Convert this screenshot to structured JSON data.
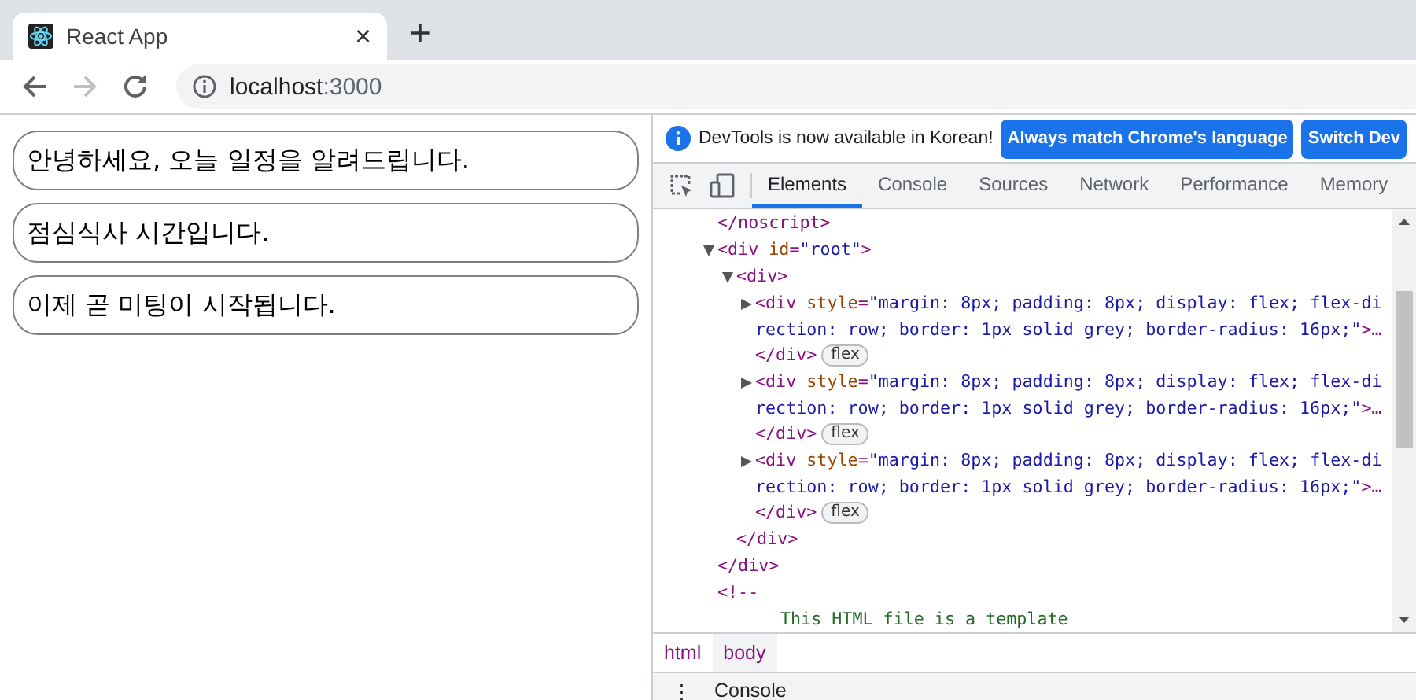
{
  "browser": {
    "tabs": [
      {
        "title": "React App",
        "selected": true,
        "close": "×"
      }
    ],
    "new_tab": "+",
    "nav": {
      "forward_disabled": true
    },
    "address": {
      "host": "localhost",
      "port": ":3000"
    }
  },
  "page": {
    "messages": [
      "안녕하세요, 오늘 일정을 알려드립니다.",
      "점심식사 시간입니다.",
      "이제 곧 미팅이 시작됩니다."
    ]
  },
  "devtools": {
    "infobar": {
      "message": "DevTools is now available in Korean!",
      "buttons": [
        "Always match Chrome's language",
        "Switch Dev"
      ]
    },
    "tabs": [
      {
        "label": "Elements",
        "selected": true
      },
      {
        "label": "Console",
        "selected": false
      },
      {
        "label": "Sources",
        "selected": false
      },
      {
        "label": "Network",
        "selected": false
      },
      {
        "label": "Performance",
        "selected": false
      },
      {
        "label": "Memory",
        "selected": false
      }
    ],
    "dom": [
      {
        "kind": "tag",
        "text": "</noscript>"
      },
      {
        "kind": "tag",
        "text": "<div id=\"root\">",
        "expanded": true,
        "close": "</div>",
        "children": [
          {
            "kind": "tag",
            "text": "<div>",
            "expanded": true,
            "close": "</div>",
            "children": [
              {
                "kind": "tag",
                "text": "<div style=\"margin: 8px; padding: 8px; display: flex; flex-direction: row; border: 1px solid grey; border-radius: 16px;\">…",
                "expanded": false,
                "close": "</div>",
                "badge": "flex"
              },
              {
                "kind": "tag",
                "text": "<div style=\"margin: 8px; padding: 8px; display: flex; flex-direction: row; border: 1px solid grey; border-radius: 16px;\">…",
                "expanded": false,
                "close": "</div>",
                "badge": "flex"
              },
              {
                "kind": "tag",
                "text": "<div style=\"margin: 8px; padding: 8px; display: flex; flex-direction: row; border: 1px solid grey; border-radius: 16px;\">…",
                "expanded": false,
                "close": "</div>",
                "badge": "flex"
              }
            ]
          }
        ]
      },
      {
        "kind": "comment",
        "text": "<!--",
        "children": [
          {
            "kind": "comment-text",
            "text": "This HTML file is a template"
          }
        ]
      }
    ],
    "breadcrumbs": [
      {
        "label": "html",
        "selected": false
      },
      {
        "label": "body",
        "selected": true
      }
    ],
    "drawer": {
      "menu": "⋮",
      "title": "Console"
    }
  }
}
